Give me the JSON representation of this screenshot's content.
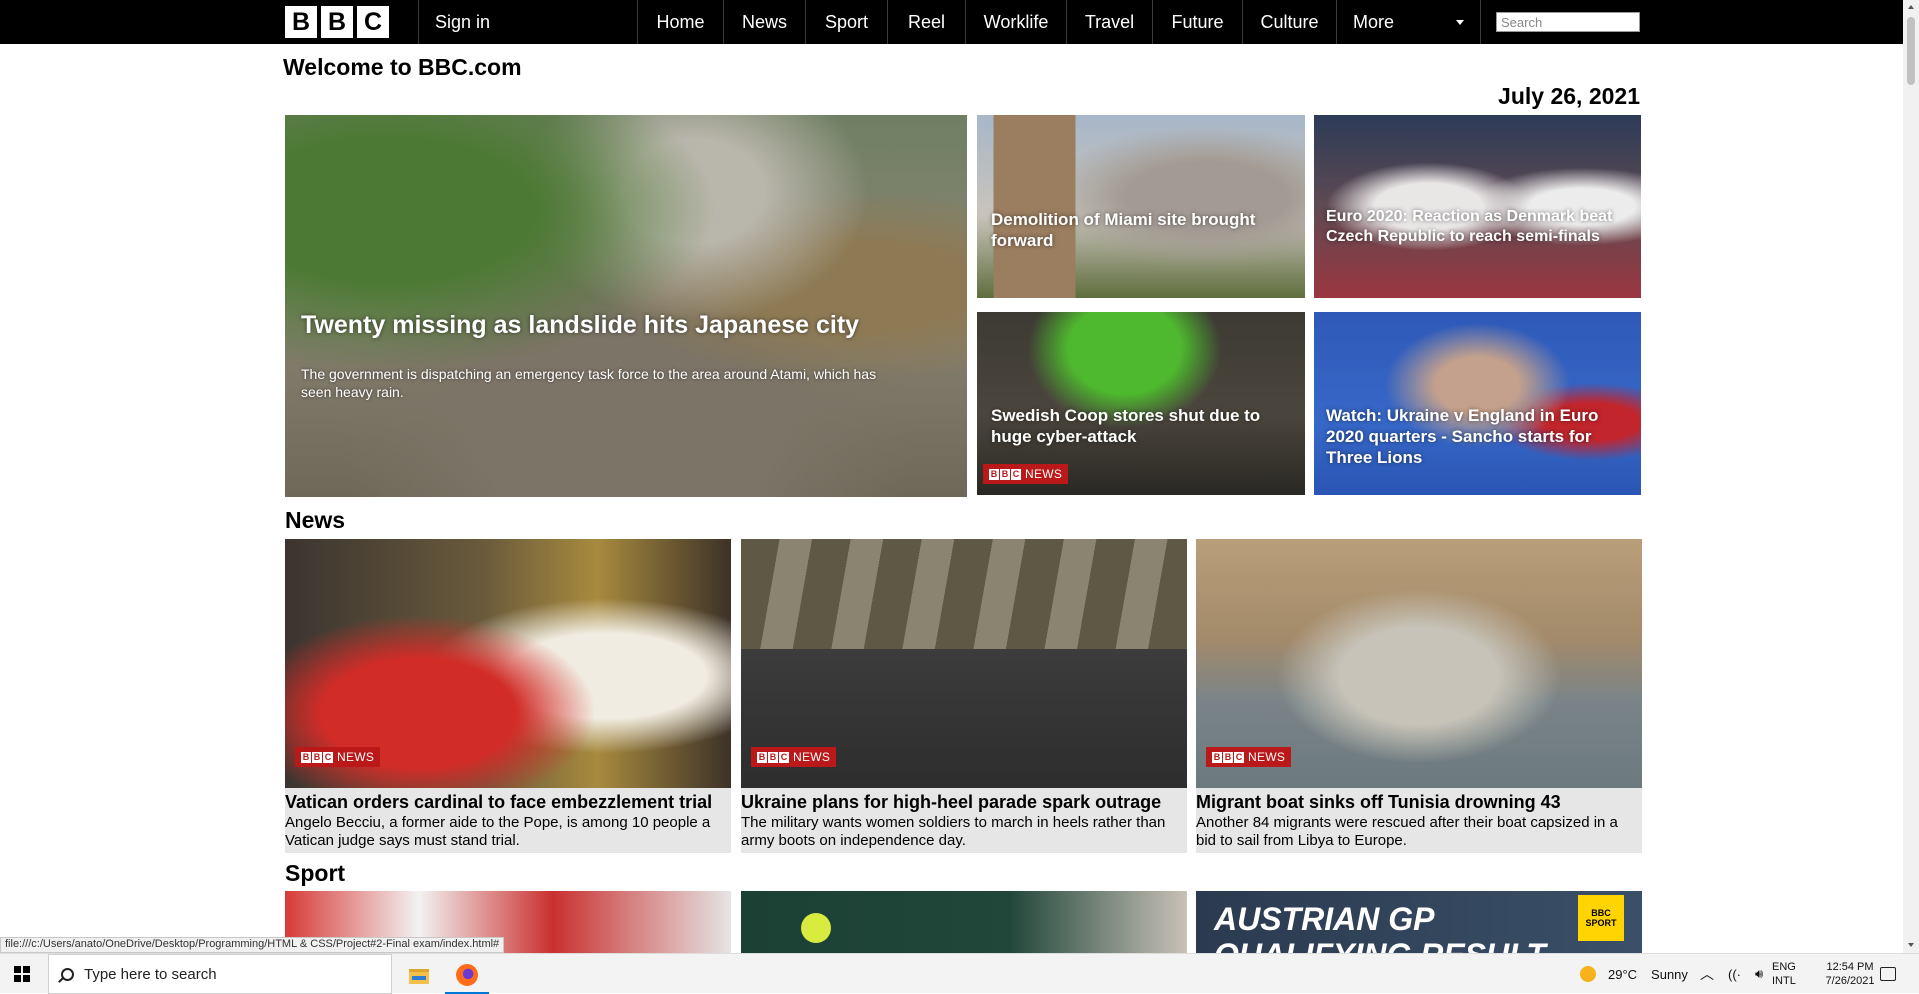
{
  "nav": {
    "logo_letters": [
      "B",
      "B",
      "C"
    ],
    "sign_in": "Sign in",
    "items": [
      {
        "label": "Home"
      },
      {
        "label": "News"
      },
      {
        "label": "Sport"
      },
      {
        "label": "Reel"
      },
      {
        "label": "Worklife"
      },
      {
        "label": "Travel"
      },
      {
        "label": "Future"
      },
      {
        "label": "Culture"
      }
    ],
    "more": "More",
    "search_placeholder": "Search"
  },
  "welcome": "Welcome to BBC.com",
  "date": "July 26, 2021",
  "hero": {
    "main": {
      "title": "Twenty missing as landslide hits Japanese city",
      "summary": "The government is dispatching an emergency task force to the area around Atami, which has seen heavy rain."
    },
    "tiles": [
      {
        "title": "Demolition of Miami site brought forward"
      },
      {
        "title": "Euro 2020: Reaction as Denmark beat Czech Republic to reach semi-finals"
      },
      {
        "title": "Swedish Coop stores shut due to huge cyber-attack"
      },
      {
        "title": "Watch: Ukraine v England in Euro 2020 quarters - Sancho starts for Three Lions"
      }
    ]
  },
  "badge": {
    "letters": [
      "B",
      "B",
      "C"
    ],
    "label": "NEWS"
  },
  "sections": {
    "news": "News",
    "sport": "Sport"
  },
  "news_cards": [
    {
      "title": "Vatican orders cardinal to face embezzlement trial",
      "summary": "Angelo Becciu, a former aide to the Pope, is among 10 people a Vatican judge says must stand trial."
    },
    {
      "title": "Ukraine plans for high-heel parade spark outrage",
      "summary": "The military wants women soldiers to march in heels rather than army boots on independence day."
    },
    {
      "title": "Migrant boat sinks off Tunisia drowning 43",
      "summary": "Another 84 migrants were rescued after their boat capsized in a bid to sail from Libya to Europe."
    }
  ],
  "sport_tiles": {
    "gp_line1": "AUSTRIAN GP",
    "gp_line2": "QUALIFYING RESULT",
    "sport_badge_top": "BBC",
    "sport_badge_bottom": "SPORT"
  },
  "status_url": "file:///c:/Users/anato/OneDrive/Desktop/Programming/HTML & CSS/Project#2-Final exam/index.html#",
  "taskbar": {
    "search_placeholder": "Type here to search",
    "weather_temp": "29°C",
    "weather_text": "Sunny",
    "lang_top": "ENG",
    "lang_bottom": "INTL",
    "time": "12:54 PM",
    "date": "7/26/2021"
  },
  "colors": {
    "nav_bg": "#000000",
    "badge_red": "#bb1919",
    "card_bg": "#e6e6e6",
    "sport_yellow": "#ffd400"
  }
}
